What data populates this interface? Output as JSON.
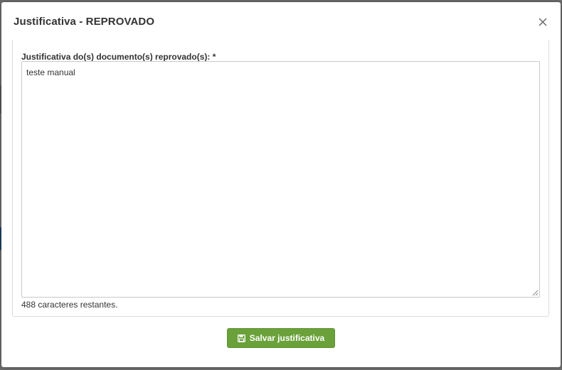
{
  "modal": {
    "title": "Justificativa - REPROVADO",
    "close_icon": "close-icon"
  },
  "form": {
    "label": "Justificativa do(s) documento(s) reprovado(s): *",
    "textarea_value": "teste manual",
    "chars_remaining": "488 caracteres restantes."
  },
  "actions": {
    "save_label": "Salvar justificativa",
    "save_icon": "floppy-disk-icon"
  },
  "colors": {
    "primary_button": "#6aa13a",
    "title_text": "#333333",
    "backdrop": "#6b6b6b"
  }
}
